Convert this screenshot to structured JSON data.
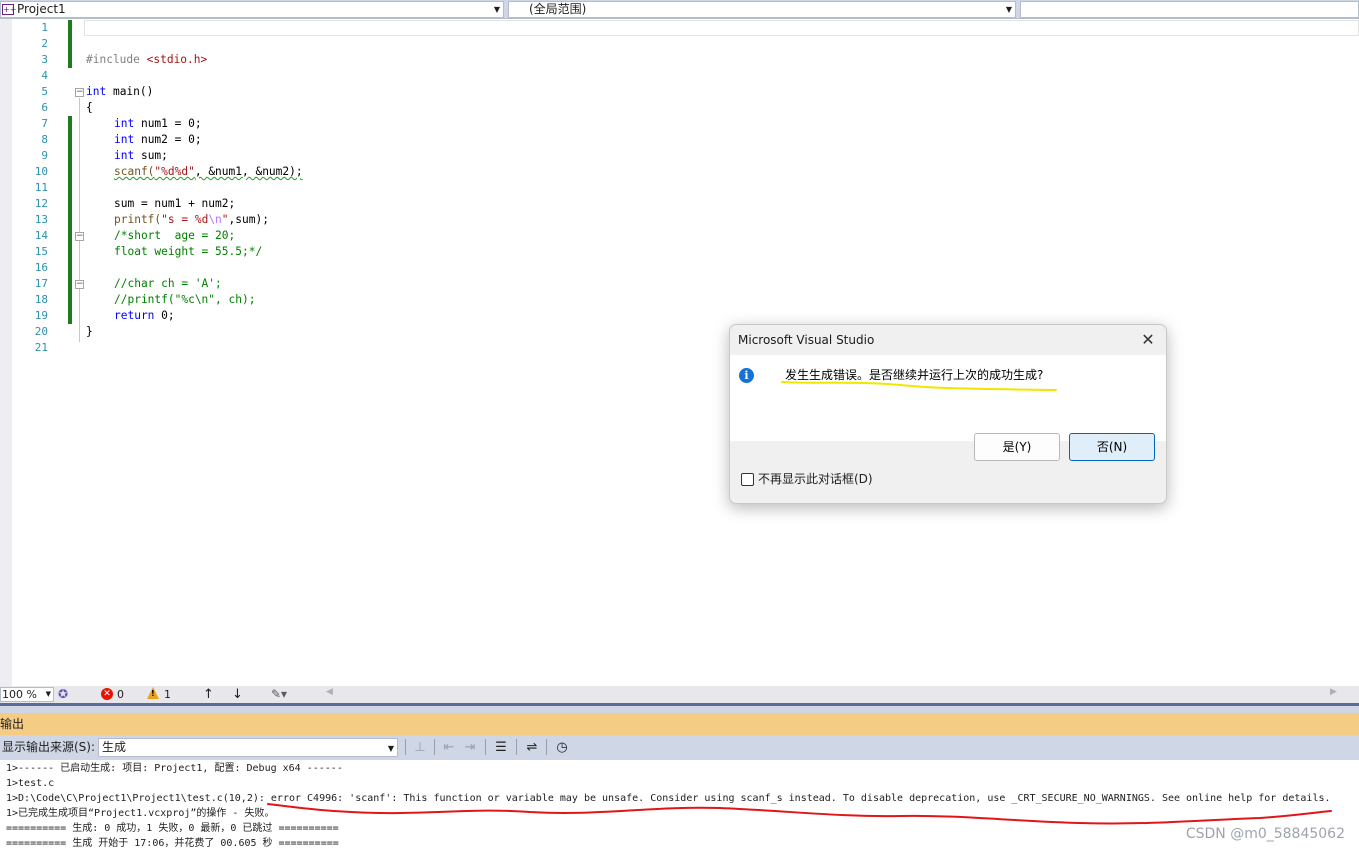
{
  "navbar": {
    "project": "Project1",
    "scope": "(全局范围)"
  },
  "editor": {
    "line_numbers": [
      "1",
      "2",
      "3",
      "4",
      "5",
      "6",
      "7",
      "8",
      "9",
      "10",
      "11",
      "12",
      "13",
      "14",
      "15",
      "16",
      "17",
      "18",
      "19",
      "20",
      "21"
    ],
    "code": {
      "l3_directive": "#include ",
      "l3_header": "<stdio.h>",
      "l5_kw": "int",
      "l5_rest": " main()",
      "l6": "{",
      "l7_kw": "int",
      "l7_rest": " num1 = 0;",
      "l8_kw": "int",
      "l8_rest": " num2 = 0;",
      "l9_kw": "int",
      "l9_rest": " sum;",
      "l10_fn": "scanf(",
      "l10_str": "\"%d%d\"",
      "l10_rest": ", &num1, &num2);",
      "l12": "sum = num1 + num2;",
      "l13_fn": "printf(",
      "l13_str1": "\"s = %d",
      "l13_esc": "\\n",
      "l13_str2": "\"",
      "l13_rest": ",sum);",
      "l14": "/*short  age = 20;",
      "l15": "float weight = 55.5;*/",
      "l17": "//char ch = 'A';",
      "l18": "//printf(\"%c\\n\", ch);",
      "l19_kw": "return",
      "l19_rest": " 0;",
      "l20": "}"
    }
  },
  "status": {
    "zoom": "100 %",
    "errors": "0",
    "warnings": "1"
  },
  "output": {
    "title": "输出",
    "source_label": "显示输出来源(S):",
    "source_value": "生成",
    "lines": [
      "1>------ 已启动生成: 项目: Project1, 配置: Debug x64 ------",
      "1>test.c",
      "1>D:\\Code\\C\\Project1\\Project1\\test.c(10,2): error C4996: 'scanf': This function or variable may be unsafe. Consider using scanf_s instead. To disable deprecation, use _CRT_SECURE_NO_WARNINGS. See online help for details.",
      "1>已完成生成项目“Project1.vcxproj”的操作 - 失败。",
      "========== 生成: 0 成功，1 失败，0 最新，0 已跳过 ==========",
      "========== 生成 开始于 17:06，并花费了 00.605 秒 =========="
    ]
  },
  "dialog": {
    "title": "Microsoft Visual Studio",
    "message": "发生生成错误。是否继续并运行上次的成功生成?",
    "yes_label": "是(Y)",
    "no_label": "否(N)",
    "checkbox_label": "不再显示此对话框(D)"
  },
  "watermark": "CSDN @m0_58845062",
  "colors": {
    "keyword": "#0000ff",
    "string": "#a31515",
    "comment": "#008000",
    "change_bar": "#1e7b1e",
    "output_title": "#f5cc84",
    "annotation_yellow": "#f2e600",
    "annotation_red": "#e0161b"
  }
}
